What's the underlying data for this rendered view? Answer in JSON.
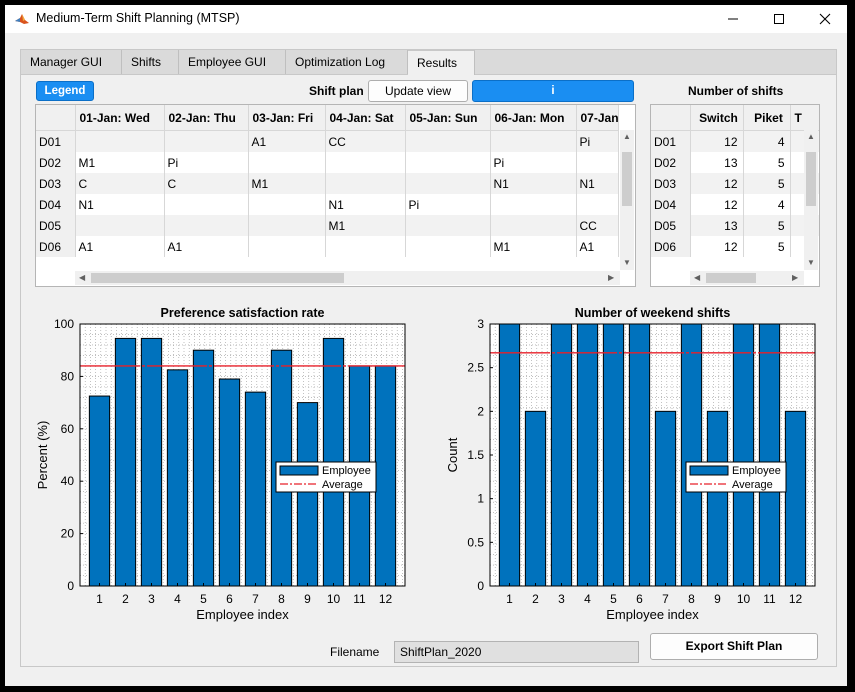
{
  "window": {
    "title": "Medium-Term Shift Planning (MTSP)",
    "app_icon": "matlab-icon",
    "controls": [
      "minimize-icon",
      "maximize-icon",
      "close-icon"
    ]
  },
  "tabs": [
    {
      "label": "Manager GUI",
      "active": false
    },
    {
      "label": "Shifts",
      "active": false
    },
    {
      "label": "Employee GUI",
      "active": false
    },
    {
      "label": "Optimization Log",
      "active": false
    },
    {
      "label": "Results",
      "active": true
    }
  ],
  "controls": {
    "legend_button": "Legend",
    "shift_plan_label": "Shift plan",
    "update_view_button": "Update view",
    "info_button": "i",
    "num_shifts_label": "Number of shifts",
    "filename_label": "Filename",
    "filename_value": "ShiftPlan_2020",
    "export_button": "Export Shift Plan"
  },
  "shift_plan": {
    "columns": [
      "01-Jan: Wed",
      "02-Jan: Thu",
      "03-Jan: Fri",
      "04-Jan: Sat",
      "05-Jan: Sun",
      "06-Jan: Mon",
      "07-Jan"
    ],
    "rows": [
      {
        "id": "D01",
        "cells": [
          "",
          "",
          "A1",
          "CC",
          "",
          "",
          "Pi"
        ]
      },
      {
        "id": "D02",
        "cells": [
          "M1",
          "Pi",
          "",
          "",
          "",
          "Pi",
          ""
        ]
      },
      {
        "id": "D03",
        "cells": [
          "C",
          "C",
          "M1",
          "",
          "",
          "N1",
          "N1"
        ]
      },
      {
        "id": "D04",
        "cells": [
          "N1",
          "",
          "",
          "N1",
          "Pi",
          "",
          ""
        ]
      },
      {
        "id": "D05",
        "cells": [
          "",
          "",
          "",
          "M1",
          "",
          "",
          "CC"
        ]
      },
      {
        "id": "D06",
        "cells": [
          "A1",
          "A1",
          "",
          "",
          "",
          "M1",
          "A1"
        ]
      }
    ]
  },
  "num_shifts": {
    "columns": [
      "Switch",
      "Piket",
      "T"
    ],
    "rows": [
      {
        "id": "D01",
        "cells": [
          "12",
          "4",
          ""
        ]
      },
      {
        "id": "D02",
        "cells": [
          "13",
          "5",
          ""
        ]
      },
      {
        "id": "D03",
        "cells": [
          "12",
          "5",
          ""
        ]
      },
      {
        "id": "D04",
        "cells": [
          "12",
          "4",
          ""
        ]
      },
      {
        "id": "D05",
        "cells": [
          "13",
          "5",
          ""
        ]
      },
      {
        "id": "D06",
        "cells": [
          "12",
          "5",
          ""
        ]
      }
    ]
  },
  "chart_data": [
    {
      "type": "bar",
      "title": "Preference satisfaction rate",
      "xlabel": "Employee index",
      "ylabel": "Percent (%)",
      "categories": [
        "1",
        "2",
        "3",
        "4",
        "5",
        "6",
        "7",
        "8",
        "9",
        "10",
        "11",
        "12"
      ],
      "series": [
        {
          "name": "Employee",
          "values": [
            72.5,
            94.5,
            94.5,
            82.5,
            90,
            79,
            74,
            90,
            70,
            94.5,
            84,
            84
          ]
        }
      ],
      "average": {
        "name": "Average",
        "value": 84
      },
      "ylim": [
        0,
        100
      ],
      "yticks": [
        "0",
        "20",
        "40",
        "60",
        "80",
        "100"
      ],
      "grid": true,
      "legend_position": "middle-right",
      "colors": {
        "bar": "#0072bd",
        "average": "#e8202a"
      }
    },
    {
      "type": "bar",
      "title": "Number of weekend shifts",
      "xlabel": "Employee index",
      "ylabel": "Count",
      "categories": [
        "1",
        "2",
        "3",
        "4",
        "5",
        "6",
        "7",
        "8",
        "9",
        "10",
        "11",
        "12"
      ],
      "series": [
        {
          "name": "Employee",
          "values": [
            3,
            2,
            3,
            3,
            3,
            3,
            2,
            3,
            2,
            3,
            3,
            2
          ]
        }
      ],
      "average": {
        "name": "Average",
        "value": 2.67
      },
      "ylim": [
        0,
        3
      ],
      "yticks": [
        "0",
        "0.5",
        "1",
        "1.5",
        "2",
        "2.5",
        "3"
      ],
      "grid": true,
      "legend_position": "middle-right",
      "colors": {
        "bar": "#0072bd",
        "average": "#e8202a"
      }
    }
  ]
}
